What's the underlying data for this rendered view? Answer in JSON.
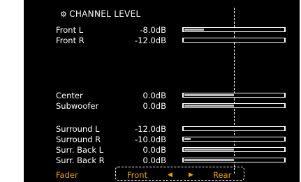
{
  "header": {
    "title": "CHANNEL LEVEL",
    "icon": "gear-icon"
  },
  "channels": [
    {
      "label": "Front L",
      "value": "-8.0dB",
      "level": 0.2
    },
    {
      "label": "Front R",
      "value": "-12.0dB",
      "level": 0.0
    },
    {
      "label": "Center",
      "value": "0.0dB",
      "level": 0.5
    },
    {
      "label": "Subwoofer",
      "value": "0.0dB",
      "level": 0.5
    },
    {
      "label": "Surround L",
      "value": "-12.0dB",
      "level": 0.0
    },
    {
      "label": "Surround R",
      "value": "-10.0dB",
      "level": 0.06
    },
    {
      "label": "Surr. Back L",
      "value": "0.0dB",
      "level": 0.5
    },
    {
      "label": "Surr. Back R",
      "value": "0.0dB",
      "level": 0.5
    }
  ],
  "fader": {
    "label": "Fader",
    "front": "Front",
    "rear": "Rear",
    "left_arrow": "◀",
    "right_arrow": "▶"
  },
  "colors": {
    "background": "#000000",
    "text": "#ffffff",
    "accent": "#f0a000",
    "bar_fill": "#bdbdbd"
  }
}
